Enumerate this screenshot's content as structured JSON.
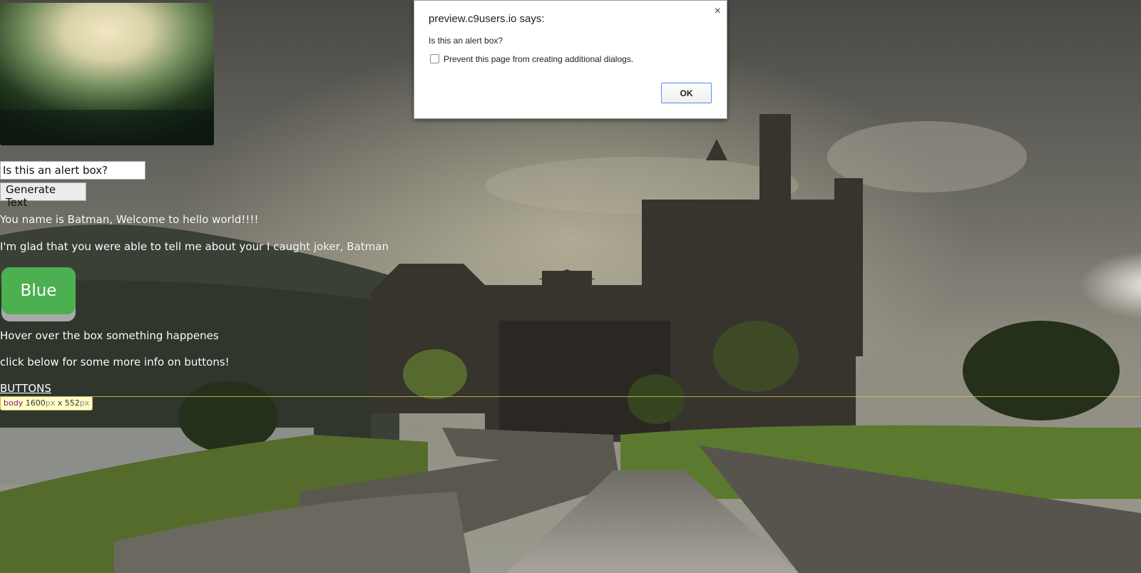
{
  "page": {
    "input_value": "Is this an alert box?",
    "generate_button_label": "Generate Text",
    "welcome_text": "You name is Batman, Welcome to hello world!!!!",
    "glad_text": "I'm glad that you were able to tell me about your I caught joker, Batman",
    "blue_button_label": "Blue",
    "hover_text": "Hover over the box something happenes",
    "info_text": "click below for some more info on buttons!",
    "buttons_link": "BUTTONS"
  },
  "devtools_tooltip": {
    "tag": "body",
    "width": "1600",
    "height": "552",
    "unit": "px",
    "separator": "x"
  },
  "dialog": {
    "title": "preview.c9users.io says:",
    "close_glyph": "×",
    "message": "Is this an alert box?",
    "checkbox_label": "Prevent this page from creating additional dialogs.",
    "ok_label": "OK"
  },
  "colors": {
    "blue_button_bg": "#4caf50",
    "dialog_ok_border": "#4d90fe",
    "tooltip_bg": "#ffffc5"
  },
  "icons": {
    "close": "close-icon",
    "checkbox": "checkbox-icon"
  }
}
